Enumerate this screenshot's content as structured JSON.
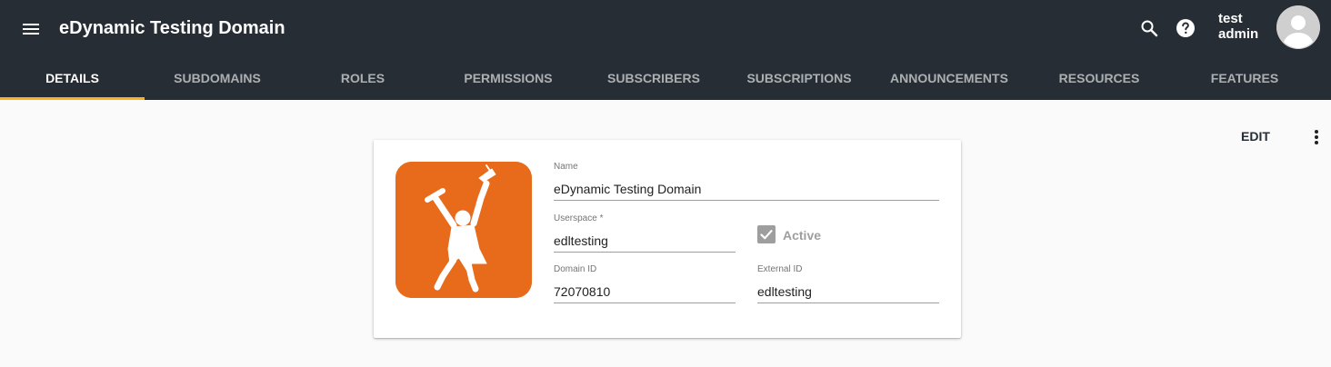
{
  "app": {
    "title": "eDynamic Testing Domain"
  },
  "user": {
    "first_line": "test",
    "second_line": "admin"
  },
  "tabs": [
    {
      "label": "DETAILS",
      "active": true
    },
    {
      "label": "SUBDOMAINS",
      "active": false
    },
    {
      "label": "ROLES",
      "active": false
    },
    {
      "label": "PERMISSIONS",
      "active": false
    },
    {
      "label": "SUBSCRIBERS",
      "active": false
    },
    {
      "label": "SUBSCRIPTIONS",
      "active": false
    },
    {
      "label": "ANNOUNCEMENTS",
      "active": false
    },
    {
      "label": "RESOURCES",
      "active": false
    },
    {
      "label": "FEATURES",
      "active": false
    }
  ],
  "actions": {
    "edit_label": "EDIT"
  },
  "details": {
    "name": {
      "label": "Name",
      "value": "eDynamic Testing Domain"
    },
    "userspace": {
      "label": "Userspace *",
      "value": "edltesting"
    },
    "active": {
      "label": "Active",
      "checked": true
    },
    "domain_id": {
      "label": "Domain ID",
      "value": "72070810"
    },
    "external_id": {
      "label": "External ID",
      "value": "edltesting"
    }
  },
  "colors": {
    "topbar": "#262d34",
    "tab_indicator": "#f5b323",
    "logo_background": "#e76b1a",
    "page_background": "#fafafa"
  },
  "icons": {
    "menu": "menu-icon",
    "search": "search-icon",
    "help": "help-icon",
    "avatar": "account-icon",
    "more": "more-vert-icon",
    "check": "check-icon",
    "logo": "graduate-logo-icon"
  }
}
